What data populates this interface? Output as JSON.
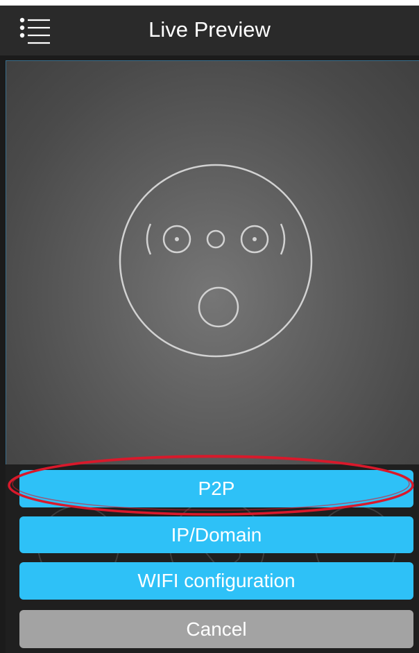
{
  "header": {
    "title": "Live Preview",
    "menu_icon": "hamburger-menu-icon"
  },
  "preview": {
    "placeholder_icon": "surprised-camera-face-icon",
    "background_color": "#5e5e5e"
  },
  "action_sheet": {
    "buttons": [
      {
        "label": "P2P",
        "color": "#2ec1f7",
        "highlighted": true
      },
      {
        "label": "IP/Domain",
        "color": "#2ec1f7"
      },
      {
        "label": "WIFI configuration",
        "color": "#2ec1f7"
      },
      {
        "label": "Cancel",
        "color": "#a3a3a3"
      }
    ]
  },
  "annotation": {
    "shape": "ellipse",
    "color": "#d9192b",
    "target": "P2P"
  },
  "colors": {
    "header_bg": "#2a2a2a",
    "accent_blue": "#2ec1f7",
    "cancel_gray": "#a3a3a3",
    "sheet_bg": "#1f1f1f"
  }
}
